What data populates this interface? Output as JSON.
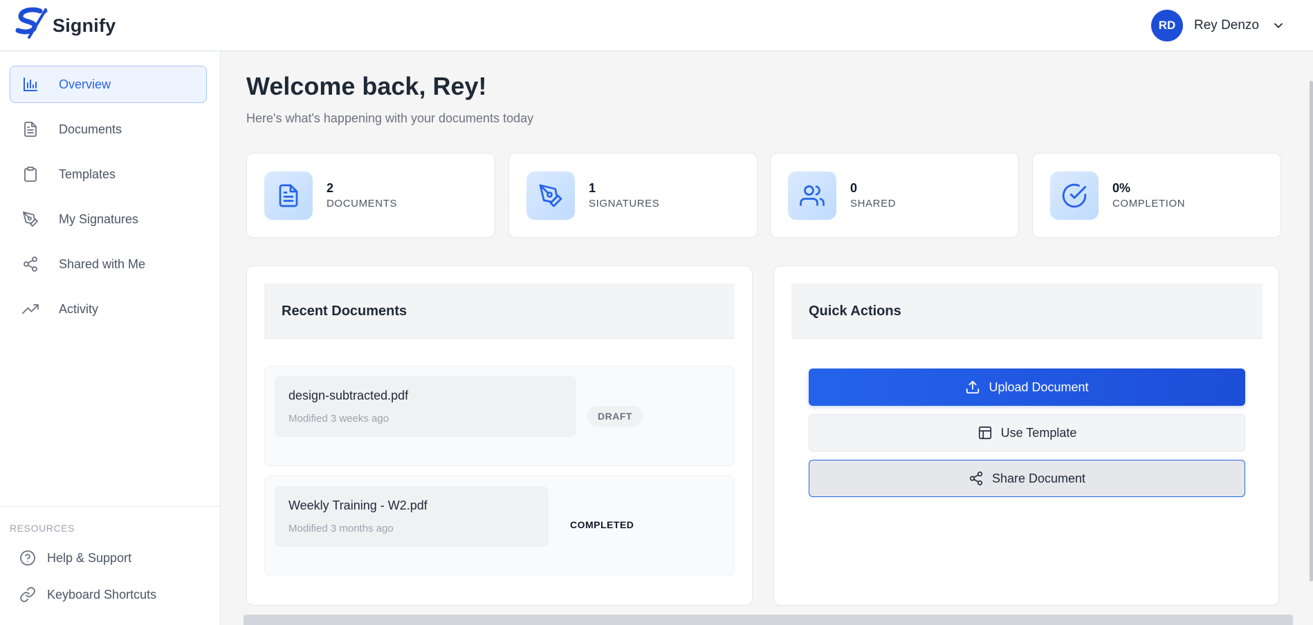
{
  "app": {
    "name": "Signify"
  },
  "user": {
    "initials": "RD",
    "name": "Rey Denzo"
  },
  "sidebar": {
    "items": [
      {
        "label": "Overview",
        "icon": "bar-chart-icon",
        "active": true
      },
      {
        "label": "Documents",
        "icon": "document-icon"
      },
      {
        "label": "Templates",
        "icon": "clipboard-icon"
      },
      {
        "label": "My Signatures",
        "icon": "pen-tool-icon"
      },
      {
        "label": "Shared with Me",
        "icon": "share-icon"
      },
      {
        "label": "Activity",
        "icon": "trending-up-icon"
      }
    ],
    "resources_title": "RESOURCES",
    "resources": [
      {
        "label": "Help & Support",
        "icon": "help-circle-icon"
      },
      {
        "label": "Keyboard Shortcuts",
        "icon": "link-icon"
      }
    ]
  },
  "main": {
    "welcome": "Welcome back, Rey!",
    "subtitle": "Here's what's happening with your documents today",
    "stats": [
      {
        "value": "2",
        "label": "DOCUMENTS",
        "icon": "document-icon"
      },
      {
        "value": "1",
        "label": "SIGNATURES",
        "icon": "pen-tool-icon"
      },
      {
        "value": "0",
        "label": "SHARED",
        "icon": "users-icon"
      },
      {
        "value": "0%",
        "label": "COMPLETION",
        "icon": "check-circle-icon"
      }
    ],
    "recent": {
      "title": "Recent Documents",
      "docs": [
        {
          "name": "design-subtracted.pdf",
          "modified": "Modified 3 weeks ago",
          "status": "DRAFT"
        },
        {
          "name": "Weekly Training - W2.pdf",
          "modified": "Modified 3 months ago",
          "status": "COMPLETED"
        }
      ]
    },
    "quick": {
      "title": "Quick Actions",
      "upload": "Upload Document",
      "template": "Use Template",
      "share": "Share Document"
    }
  },
  "colors": {
    "accent": "#2563eb",
    "accent_dark": "#1d4ed8",
    "icon_bg": "#dbeafe"
  }
}
